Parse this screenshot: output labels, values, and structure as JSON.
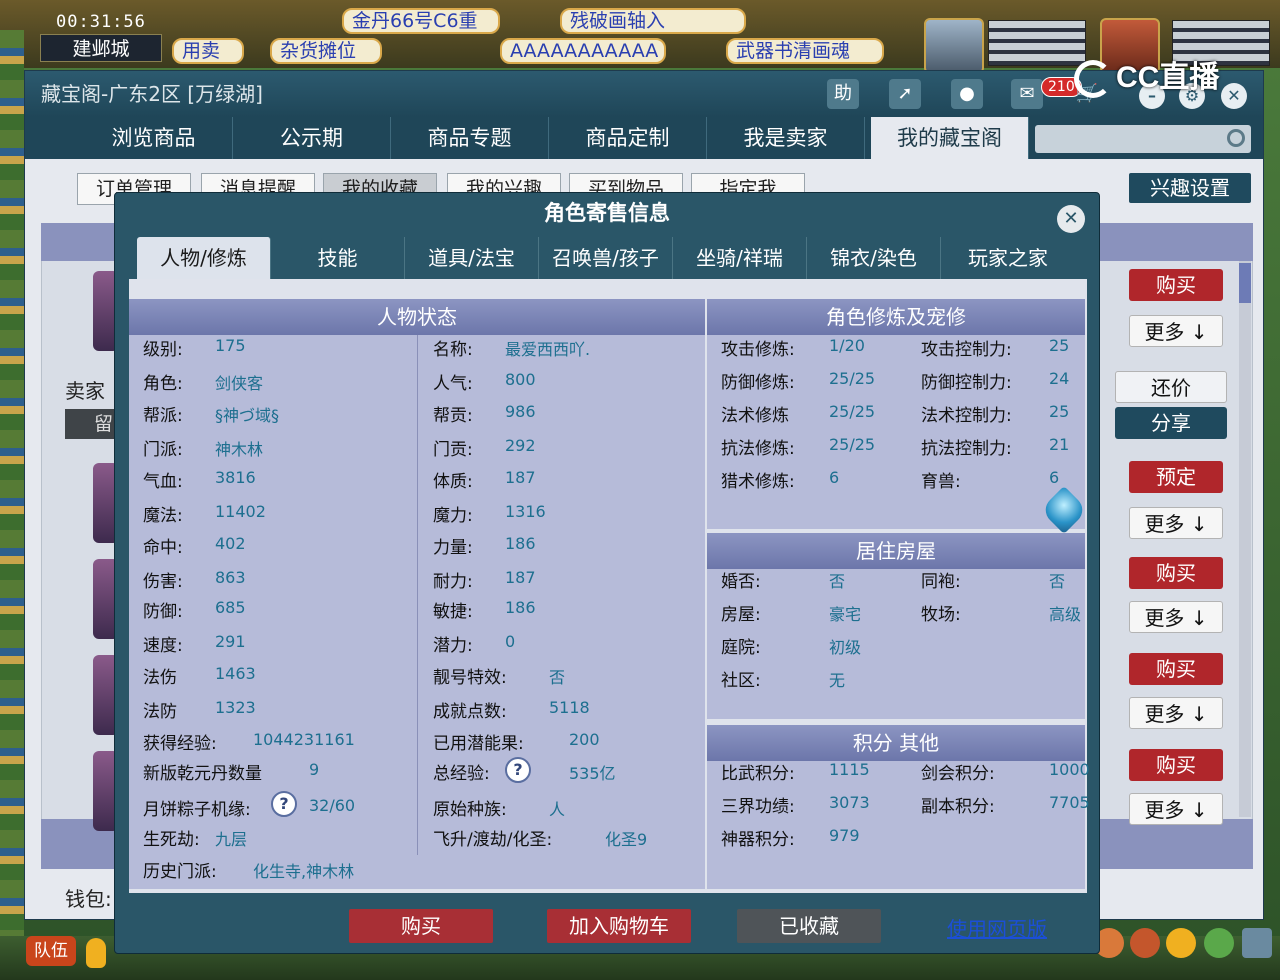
{
  "hud": {
    "clock": "00:31:56",
    "city": "建邺城",
    "tickers": [
      "用卖",
      "杂货摊位",
      "AAAAAAAAAAA",
      "武器书清画魂",
      "金丹66号C6重",
      "残破画轴入"
    ],
    "team_button": "队伍",
    "cc_logo": "CC直播"
  },
  "window": {
    "title": "藏宝阁-广东2区 [万绿湖]",
    "help_button": "助",
    "cart_badge": "210",
    "nav_tabs": [
      "浏览商品",
      "公示期",
      "商品专题",
      "商品定制",
      "我是卖家",
      "我的藏宝阁"
    ],
    "sub_tabs": [
      "订单管理",
      "消息提醒",
      "我的收藏",
      "我的兴趣",
      "买到物品",
      "指定我"
    ],
    "interest_button": "兴趣设置",
    "seller_label": "卖家",
    "seller_value": "留",
    "wallet_label": "钱包:",
    "side_buttons": {
      "buy": "购买",
      "more": "更多 ↓",
      "counter": "还价",
      "share": "分享",
      "reserve": "预定"
    }
  },
  "modal": {
    "title": "角色寄售信息",
    "tabs": [
      "人物/修炼",
      "技能",
      "道具/法宝",
      "召唤兽/孩子",
      "坐骑/祥瑞",
      "锦衣/染色",
      "玩家之家"
    ],
    "status_panel": {
      "title": "人物状态",
      "left": [
        {
          "label": "级别:",
          "value": "175"
        },
        {
          "label": "角色:",
          "value": "剑侠客"
        },
        {
          "label": "帮派:",
          "value": "§神づ域§"
        },
        {
          "label": "门派:",
          "value": "神木林"
        },
        {
          "label": "气血:",
          "value": "3816"
        },
        {
          "label": "魔法:",
          "value": "11402"
        },
        {
          "label": "命中:",
          "value": "402"
        },
        {
          "label": "伤害:",
          "value": "863"
        },
        {
          "label": "防御:",
          "value": "685"
        },
        {
          "label": "速度:",
          "value": "291"
        },
        {
          "label": "法伤",
          "value": "1463"
        },
        {
          "label": "法防",
          "value": "1323"
        },
        {
          "label": "获得经验:",
          "value": "1044231161"
        },
        {
          "label": "新版乾元丹数量",
          "value": "9"
        },
        {
          "label": "月饼粽子机缘:",
          "value": "32/60"
        },
        {
          "label": "生死劫:",
          "value": "九层"
        },
        {
          "label": "历史门派:",
          "value": "化生寺,神木林"
        }
      ],
      "right": [
        {
          "label": "名称:",
          "value": "最爱西西吖."
        },
        {
          "label": "人气:",
          "value": "800"
        },
        {
          "label": "帮贡:",
          "value": "986"
        },
        {
          "label": "门贡:",
          "value": "292"
        },
        {
          "label": "体质:",
          "value": "187"
        },
        {
          "label": "魔力:",
          "value": "1316"
        },
        {
          "label": "力量:",
          "value": "186"
        },
        {
          "label": "耐力:",
          "value": "187"
        },
        {
          "label": "敏捷:",
          "value": "186"
        },
        {
          "label": "潜力:",
          "value": "0"
        },
        {
          "label": "靓号特效:",
          "value": "否"
        },
        {
          "label": "成就点数:",
          "value": "5118"
        },
        {
          "label": "已用潜能果:",
          "value": "200"
        },
        {
          "label": "总经验:",
          "value": "535亿"
        },
        {
          "label": "原始种族:",
          "value": "人"
        },
        {
          "label": "飞升/渡劫/化圣:",
          "value": "化圣9"
        }
      ]
    },
    "cultivation_panel": {
      "title": "角色修炼及宠修",
      "rows": [
        {
          "l1": "攻击修炼:",
          "v1": "1/20",
          "l2": "攻击控制力:",
          "v2": "25"
        },
        {
          "l1": "防御修炼:",
          "v1": "25/25",
          "l2": "防御控制力:",
          "v2": "24"
        },
        {
          "l1": "法术修炼",
          "v1": "25/25",
          "l2": "法术控制力:",
          "v2": "25"
        },
        {
          "l1": "抗法修炼:",
          "v1": "25/25",
          "l2": "抗法控制力:",
          "v2": "21"
        },
        {
          "l1": "猎术修炼:",
          "v1": "6",
          "l2": "育兽:",
          "v2": "6"
        }
      ]
    },
    "house_panel": {
      "title": "居住房屋",
      "rows": [
        {
          "l1": "婚否:",
          "v1": "否",
          "l2": "同袍:",
          "v2": "否"
        },
        {
          "l1": "房屋:",
          "v1": "豪宅",
          "l2": "牧场:",
          "v2": "高级"
        },
        {
          "l1": "庭院:",
          "v1": "初级",
          "l2": "",
          "v2": ""
        },
        {
          "l1": "社区:",
          "v1": "无",
          "l2": "",
          "v2": ""
        }
      ]
    },
    "score_panel": {
      "title": "积分 其他",
      "rows": [
        {
          "l1": "比武积分:",
          "v1": "1115",
          "l2": "剑会积分:",
          "v2": "1000"
        },
        {
          "l1": "三界功绩:",
          "v1": "3073",
          "l2": "副本积分:",
          "v2": "7705"
        },
        {
          "l1": "神器积分:",
          "v1": "979",
          "l2": "",
          "v2": ""
        }
      ]
    },
    "buttons": {
      "buy": "购买",
      "add_cart": "加入购物车",
      "collected": "已收藏",
      "web_link": "使用网页版"
    },
    "help_glyph": "?",
    "close_glyph": "✕"
  }
}
